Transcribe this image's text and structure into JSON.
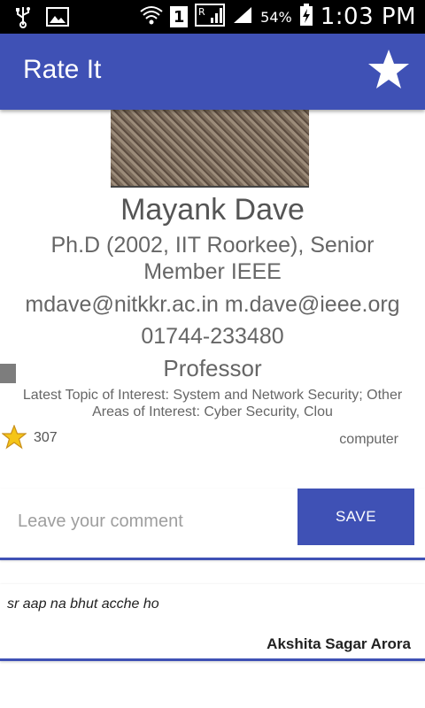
{
  "status_bar": {
    "sim_slot": "1",
    "battery_percent": "54%",
    "time": "1:03 PM"
  },
  "app_bar": {
    "title": "Rate It",
    "action_icon": "star-icon"
  },
  "profile": {
    "name": "Mayank Dave",
    "qualification": "Ph.D (2002, IIT Roorkee), Senior Member IEEE",
    "email": "mdave@nitkkr.ac.in m.dave@ieee.org",
    "phone": "01744-233480",
    "designation": "Professor",
    "interests": "Latest Topic of Interest: System and Network Security; Other Areas of Interest: Cyber Security, Clou",
    "rating_count": "307",
    "department": "computer"
  },
  "comment_form": {
    "placeholder": "Leave your comment",
    "value": "",
    "save_label": "SAVE"
  },
  "reviews": [
    {
      "text": "sr aap na bhut acche ho",
      "author": "Akshita Sagar Arora"
    }
  ],
  "colors": {
    "primary": "#3F51B5",
    "text_gray": "#666666"
  }
}
